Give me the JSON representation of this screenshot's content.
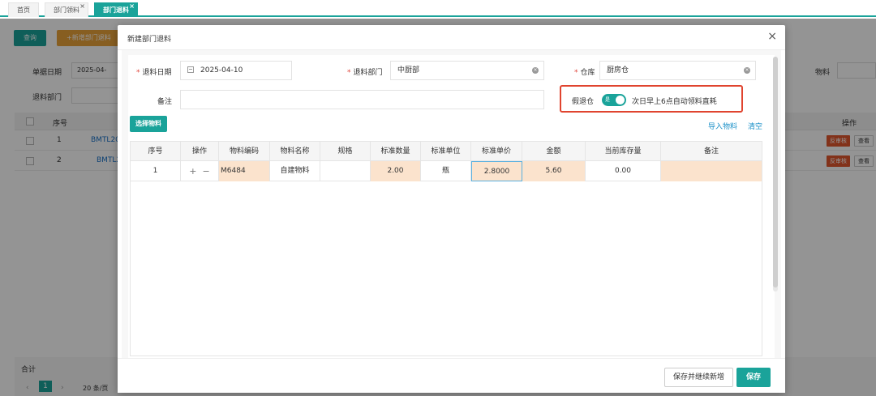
{
  "tabs": [
    {
      "label": "首页"
    },
    {
      "label": "部门领料"
    },
    {
      "label": "部门退料"
    }
  ],
  "bg": {
    "query_label": "查询",
    "add_label": "+新增部门退料",
    "doc_date_label": "单据日期",
    "doc_date_value": "2025-04-",
    "return_dept_label": "退料部门",
    "material_label": "物料",
    "col_seq": "序号",
    "col_op": "操作",
    "rows": [
      {
        "seq": "1",
        "code": "BMTL20",
        "reverse": "反审核",
        "view": "查看"
      },
      {
        "seq": "2",
        "code": "BMTL2",
        "reverse": "反审核",
        "view": "查看"
      }
    ],
    "total_label": "合计",
    "page_num": "1",
    "page_size": "20 条/页"
  },
  "modal": {
    "title": "新建部门退料",
    "close": "×",
    "return_date_label": "退料日期",
    "return_date_value": "2025-04-10",
    "return_dept_label": "退料部门",
    "return_dept_value": "中厨部",
    "warehouse_label": "仓库",
    "warehouse_value": "厨房仓",
    "remark_label": "备注",
    "fake_return_label": "假退仓",
    "toggle_text": "是",
    "toggle_desc": "次日早上6点自动领料直耗",
    "select_material": "选择物料",
    "import_material": "导入物料",
    "clear": "清空",
    "columns": [
      "序号",
      "操作",
      "物料编码",
      "物料名称",
      "规格",
      "标准数量",
      "标准单位",
      "标准单价",
      "金额",
      "当前库存量",
      "备注"
    ],
    "row": {
      "seq": "1",
      "ops": "+  −",
      "code": "M6484",
      "name": "自建物料",
      "spec": "",
      "qty": "2.00",
      "unit": "瓶",
      "price": "2.8000",
      "amount": "5.60",
      "stock": "0.00",
      "remark": ""
    },
    "save_continue": "保存并继续新增",
    "save": "保存"
  },
  "colors": {
    "accent": "#1aa39a",
    "highlight_border": "#e0442f",
    "peach": "#fbe3cd"
  }
}
